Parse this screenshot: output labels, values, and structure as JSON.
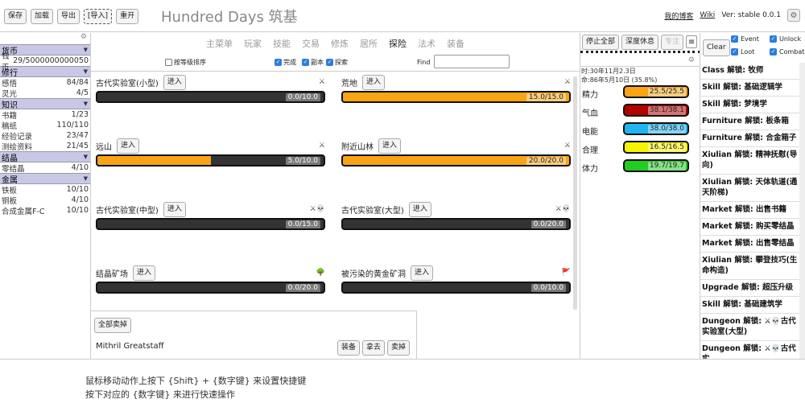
{
  "toolbar": {
    "save": "保存",
    "load": "加载",
    "export": "导出",
    "import": "[导入]",
    "restart": "重开"
  },
  "title": "Hundred Days 筑基",
  "header_links": {
    "blog": "我的博客",
    "wiki": "Wiki",
    "version": "Ver: stable 0.0.1"
  },
  "resources": {
    "categories": [
      {
        "name": "货币",
        "rows": [
          {
            "label": "钱币",
            "value": "29/5000000000050"
          }
        ]
      },
      {
        "name": "修行",
        "rows": [
          {
            "label": "感悟",
            "value": "84/84"
          },
          {
            "label": "灵光",
            "value": "4/5"
          }
        ]
      },
      {
        "name": "知识",
        "rows": [
          {
            "label": "书籍",
            "value": "1/23"
          },
          {
            "label": "稿纸",
            "value": "110/110"
          },
          {
            "label": "经验记录",
            "value": "23/47"
          },
          {
            "label": "测绘资料",
            "value": "21/45"
          }
        ]
      },
      {
        "name": "结晶",
        "rows": [
          {
            "label": "零结晶",
            "value": "4/10"
          }
        ]
      },
      {
        "name": "金属",
        "rows": [
          {
            "label": "铁板",
            "value": "10/10"
          },
          {
            "label": "铜板",
            "value": "4/10"
          },
          {
            "label": "合成金属F-C",
            "value": "10/10"
          }
        ]
      }
    ]
  },
  "tabs": [
    "主菜单",
    "玩家",
    "技能",
    "交易",
    "修炼",
    "居所",
    "探险",
    "法术",
    "装备"
  ],
  "active_tab": "探险",
  "filters": {
    "sort_level": "按等级排序",
    "done": "完成",
    "instance": "副本",
    "explore": "探索",
    "find_label": "Find"
  },
  "enter_label": "进入",
  "dungeons": [
    {
      "name": "古代实验室(小型)",
      "icon": "⚔",
      "progress": "0.0/10.0",
      "fill": 0
    },
    {
      "name": "荒地",
      "icon": "⚔",
      "progress": "15.0/15.0",
      "fill": 1.0
    },
    {
      "name": "远山",
      "icon": "⚔",
      "progress": "5.0/10.0",
      "fill": 0.5
    },
    {
      "name": "附近山林",
      "icon": "⚔",
      "progress": "20.0/20.0",
      "fill": 1.0
    },
    {
      "name": "古代实验室(中型)",
      "icon": "⚔💀",
      "progress": "0.0/15.0",
      "fill": 0
    },
    {
      "name": "古代实验室(大型)",
      "icon": "⚔💀",
      "progress": "0.0/20.0",
      "fill": 0
    },
    {
      "name": "结晶矿场",
      "icon": "🌳",
      "progress": "0.0/20.0",
      "fill": 0
    },
    {
      "name": "被污染的黄金矿洞",
      "icon": "🚩",
      "progress": "0.0/10.0",
      "fill": 0
    }
  ],
  "items": {
    "sell_all": "全部卖掉",
    "item_name": "Mithril Greatstaff",
    "equip": "装备",
    "take": "拿去",
    "sell": "卖掉"
  },
  "mid": {
    "stop_all": "停止全部",
    "deep_rest": "深度休息",
    "focus": "专注",
    "menu": "≡",
    "time_line1": "时:30年11月2.3日",
    "time_line2": "命:86年5月10日 (35.8%)"
  },
  "stats": [
    {
      "label": "精力",
      "value": "25.5/25.5",
      "fill": 1.0,
      "color": "#f8a413"
    },
    {
      "label": "气血",
      "value": "38.1/38.1",
      "fill": 1.0,
      "color": "#b30000"
    },
    {
      "label": "电能",
      "value": "38.0/38.0",
      "fill": 1.0,
      "color": "#1fb6f0"
    },
    {
      "label": "合理",
      "value": "16.5/16.5",
      "fill": 1.0,
      "color": "#f5f500"
    },
    {
      "label": "体力",
      "value": "19.7/19.7",
      "fill": 1.0,
      "color": "#22cc22"
    }
  ],
  "log_panel": {
    "clear": "Clear",
    "event": "Event",
    "unlock": "Unlock",
    "loot": "Loot",
    "combat": "Combat"
  },
  "log": [
    "Class 解锁: 牧师",
    "Skill 解锁: 基础逻辑学",
    "Skill 解锁: 梦境学",
    "Furniture 解锁: 板条箱",
    "Furniture 解锁: 合金箱子",
    "Xiulian 解锁: 精神抚慰(导向)",
    "Xiulian 解锁: 天体轨道(通天阶梯)",
    "Market 解锁: 出售书籍",
    "Market 解锁: 购买零结晶",
    "Market 解锁: 出售零结晶",
    "Xiulian 解锁: 攀登技巧(生命构造)",
    "Upgrade 解锁: 超压升级",
    "Skill 解锁: 基础建筑学",
    "Dungeon 解锁: ⚔💀古代实验室(大型)",
    "Dungeon 解锁: ⚔💀古代实"
  ],
  "hint": {
    "line1": "鼠标移动动作上按下 {Shift} + {数字键} 来设置快捷键",
    "line2": "按下对应的 {数字键} 来进行快速操作"
  }
}
